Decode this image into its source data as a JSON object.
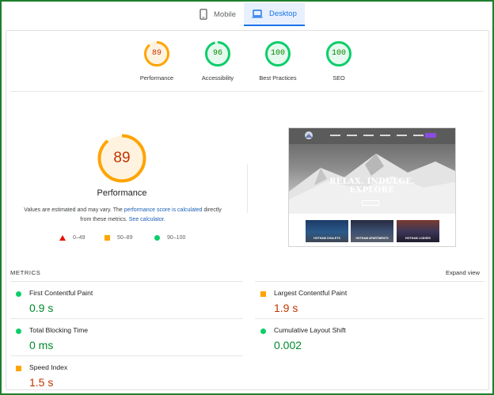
{
  "tabs": [
    {
      "label": "Mobile",
      "active": false
    },
    {
      "label": "Desktop",
      "active": true
    }
  ],
  "summary": [
    {
      "score": 89,
      "label": "Performance",
      "color": "#ffa400",
      "text_color": "#c33300",
      "fill": "#fff3e0"
    },
    {
      "score": 96,
      "label": "Accessibility",
      "color": "#0cce6b",
      "text_color": "#008800",
      "fill": "#e6f9ee"
    },
    {
      "score": 100,
      "label": "Best Practices",
      "color": "#0cce6b",
      "text_color": "#008800",
      "fill": "#e6f9ee"
    },
    {
      "score": 100,
      "label": "SEO",
      "color": "#0cce6b",
      "text_color": "#008800",
      "fill": "#e6f9ee"
    }
  ],
  "main": {
    "score": 89,
    "title": "Performance",
    "desc_prefix": "Values are estimated and may vary. The ",
    "desc_link1": "performance score is calculated",
    "desc_middle": " directly from these metrics. ",
    "desc_link2": "See calculator."
  },
  "legend": [
    {
      "range": "0–49",
      "shape": "triangle",
      "color": "#eb0f00"
    },
    {
      "range": "50–89",
      "shape": "square",
      "color": "#ffa400"
    },
    {
      "range": "90–100",
      "shape": "circle",
      "color": "#0cce6b"
    }
  ],
  "screenshot": {
    "headline_line1": "RELAX. INDULGE.",
    "headline_line2": "EXPLORE",
    "tiles": [
      "HOTHAM CHALETS",
      "HOTHAM APARTMENTS",
      "HOTHAM LODGES"
    ]
  },
  "metrics": {
    "header": "METRICS",
    "expand_label": "Expand view",
    "items": [
      {
        "name": "First Contentful Paint",
        "value": "0.9 s",
        "status": "good"
      },
      {
        "name": "Largest Contentful Paint",
        "value": "1.9 s",
        "status": "average"
      },
      {
        "name": "Total Blocking Time",
        "value": "0 ms",
        "status": "good"
      },
      {
        "name": "Cumulative Layout Shift",
        "value": "0.002",
        "status": "good"
      },
      {
        "name": "Speed Index",
        "value": "1.5 s",
        "status": "average"
      }
    ]
  },
  "colors": {
    "frame": "#1e7e2c",
    "good": "#0cce6b",
    "average": "#ffa400",
    "fail": "#eb0f00",
    "link": "#1a5fb4"
  }
}
